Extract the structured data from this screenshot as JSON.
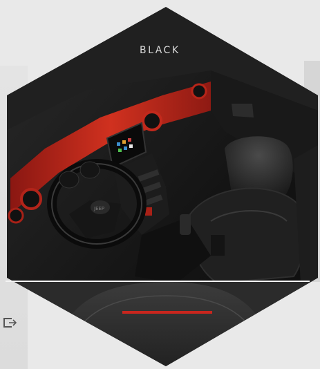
{
  "gallery": {
    "swatch_label": "BLACK"
  },
  "colors": {
    "accent_red": "#c8261e",
    "interior_black": "#1a1a1a",
    "background": "#e9e9e9"
  },
  "icons": {
    "expand": "expand-icon"
  }
}
